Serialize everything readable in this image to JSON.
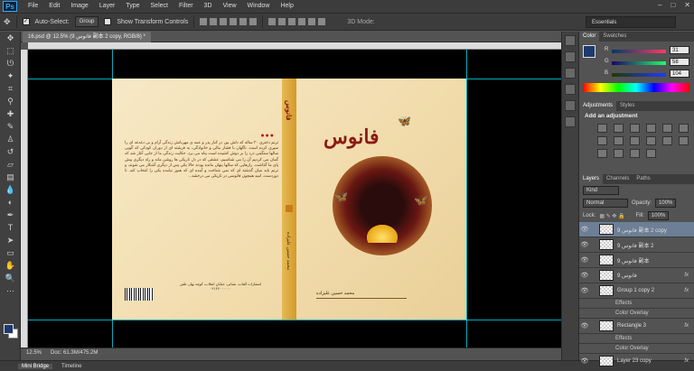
{
  "menubar": {
    "logo": "Ps",
    "items": [
      "File",
      "Edit",
      "Image",
      "Layer",
      "Type",
      "Select",
      "Filter",
      "3D",
      "View",
      "Window",
      "Help"
    ],
    "window_controls": [
      "–",
      "□",
      "✕"
    ]
  },
  "options": {
    "auto_select_label": "Auto-Select:",
    "auto_select_value": "Group",
    "show_transform_label": "Show Transform Controls",
    "mode_3d_label": "3D Mode:",
    "workspace": "Essentials"
  },
  "document": {
    "tab_label": "16.psd @ 12.5% (فانوس 9 副本 2 copy, RGB/8) *",
    "zoom": "12.5%",
    "doc_size": "Doc: 61.3M/475.2M"
  },
  "cover": {
    "front_title": "فانوس",
    "spine_title": "فانوس",
    "spine_author": "محمد حسین علیزاده",
    "front_author": "محمد حسین علیزاده",
    "back_paragraph": "ترنم دختری ۲۰ ساله که دلش بین در کنار پدر و عمه ی مهربانش زندگی آرام و بی دغدغه ای را سپری کرده است. ناگهان با فشار مالی و خانوادگی، به فرشته ای از دوران کودکی که گویی سالها سنگینی درد را بر دوش کشیده است پناه می برد. حکایت زندگی ما از جایی آغاز شد که گمان می کردیم آن را می شناسیم، عشقی که در دل تاریکی ها روشن ماند و راه دیگری پیش پای ما گذاشت. رازهایی که سالها پنهان مانده بودند حالا یکی پس از دیگری آشکار می شوند، و ترنم باید میان گذشته ای که نمی شناخت و آینده ای که هنوز نیامده یکی را انتخاب کند. تا دوردست، امید همچون فانوسی در تاریکی می درخشد...",
    "back_closing": "تا دوردست، فانوسی در تاریکی...",
    "publisher": "انتشارات آفتاب، نشانی: خیابان انقلاب، کوچه بهار، تلفن ۰۲۱۶۶۰۰۰۰۰۰"
  },
  "panels": {
    "color_tabs": [
      "Color",
      "Swatches"
    ],
    "rgb": [
      {
        "label": "R",
        "value": "31"
      },
      {
        "label": "G",
        "value": "58"
      },
      {
        "label": "B",
        "value": "104"
      }
    ],
    "adjust_tabs": [
      "Adjustments",
      "Styles"
    ],
    "adjust_title": "Add an adjustment",
    "layers_tabs": [
      "Layers",
      "Channels",
      "Paths"
    ],
    "kind": "Kind",
    "blend": "Normal",
    "opacity_label": "Opacity:",
    "opacity": "100%",
    "lock_label": "Lock:",
    "fill_label": "Fill:",
    "fill": "100%",
    "layers": [
      {
        "name": "فانوس 9 副本 2 copy",
        "fx": false,
        "selected": true
      },
      {
        "name": "فانوس 9 副本 2",
        "fx": false,
        "selected": false
      },
      {
        "name": "فانوس 9 副本",
        "fx": false,
        "selected": false
      },
      {
        "name": "فانوس 9",
        "fx": true,
        "selected": false
      },
      {
        "name": "Group 1 copy 2",
        "fx": true,
        "selected": false
      },
      {
        "name": "Rectangle 3",
        "fx": true,
        "selected": false
      },
      {
        "name": "Layer 23 copy",
        "fx": true,
        "selected": false
      }
    ],
    "sub_effects": "Effects",
    "sub_overlay": "Color Overlay"
  },
  "bottom": {
    "tabs": [
      "Mini Bridge",
      "Timeline"
    ]
  },
  "colors": {
    "fg": "#1e3a6e",
    "accent": "#8b1a15"
  }
}
